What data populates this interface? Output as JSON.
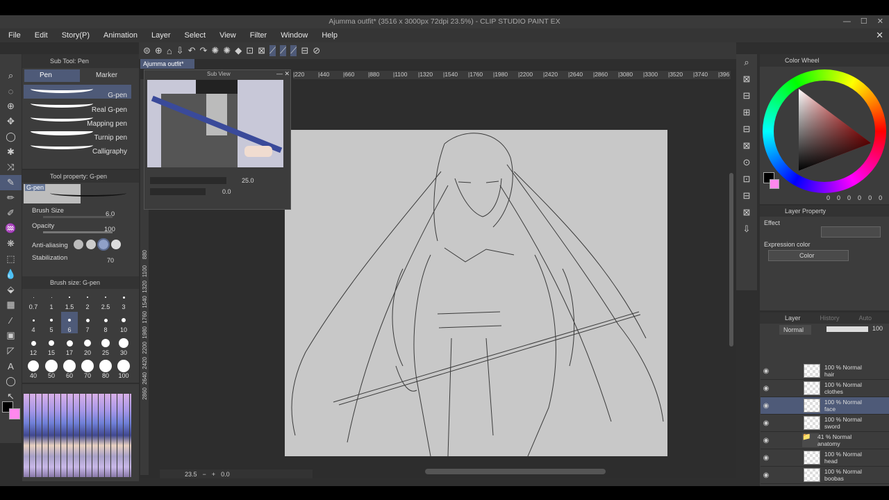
{
  "window": {
    "title": "Ajumma outfit* (3516 x 3000px 72dpi 23.5%)  - CLIP STUDIO PAINT EX"
  },
  "menu": [
    "File",
    "Edit",
    "Story(P)",
    "Animation",
    "Layer",
    "Select",
    "View",
    "Filter",
    "Window",
    "Help"
  ],
  "subtool": {
    "header": "Sub Tool: Pen",
    "tabs": [
      "Pen",
      "Marker"
    ],
    "brushes": [
      "G-pen",
      "Real G-pen",
      "Mapping pen",
      "Turnip pen",
      "Calligraphy"
    ]
  },
  "tool_property": {
    "header": "Tool property: G-pen",
    "preset_label": "G-pen",
    "brush_size_label": "Brush Size",
    "brush_size": "6.0",
    "opacity_label": "Opacity",
    "opacity": "100",
    "antialias_label": "Anti-aliasing",
    "stabilization_label": "Stabilization",
    "stabilization": "70"
  },
  "brush_size_panel": {
    "header": "Brush size: G-pen",
    "sizes": [
      "0.7",
      "1",
      "1.5",
      "2",
      "2.5",
      "3",
      "4",
      "5",
      "6",
      "7",
      "8",
      "10",
      "12",
      "15",
      "17",
      "20",
      "25",
      "30",
      "40",
      "50",
      "60",
      "70",
      "80",
      "100"
    ]
  },
  "canvas": {
    "tab": "Ajumma outfit*",
    "subview_title": "Sub View",
    "subview_zoom": "25.0",
    "subview_angle": "0.0",
    "zoom": "23.5",
    "angle": "0.0",
    "ruler_ticks": [
      "220",
      "440",
      "660",
      "880",
      "1100",
      "1320",
      "1540",
      "1760",
      "1980",
      "2200",
      "2420",
      "2640",
      "2860",
      "3080",
      "3300",
      "3520",
      "3740",
      "396"
    ],
    "vruler_ticks": [
      "880",
      "1100",
      "1320",
      "1540",
      "1760",
      "1980",
      "2200",
      "2420",
      "2640",
      "2860"
    ]
  },
  "color_wheel": {
    "header": "Color Wheel",
    "values": [
      "0",
      "0",
      "0",
      "0",
      "0",
      "0"
    ],
    "fg_color": "#000000",
    "bg_color": "#ff88ee"
  },
  "layer_property": {
    "header": "Layer Property",
    "effect_label": "Effect",
    "expression_label": "Expression color",
    "expression_value": "Color"
  },
  "layer_panel": {
    "tabs": [
      "Layer",
      "History",
      "Auto Action"
    ],
    "blend_mode": "Normal",
    "opacity": "100",
    "layers": [
      {
        "mode": "100 % Normal",
        "name": "hair"
      },
      {
        "mode": "100 % Normal",
        "name": "clothes"
      },
      {
        "mode": "100 % Normal",
        "name": "face"
      },
      {
        "mode": "100 % Normal",
        "name": "sword"
      },
      {
        "mode": "41 % Normal",
        "name": "anatomy"
      },
      {
        "mode": "100 % Normal",
        "name": "head"
      },
      {
        "mode": "100 % Normal",
        "name": "boobas"
      }
    ]
  }
}
